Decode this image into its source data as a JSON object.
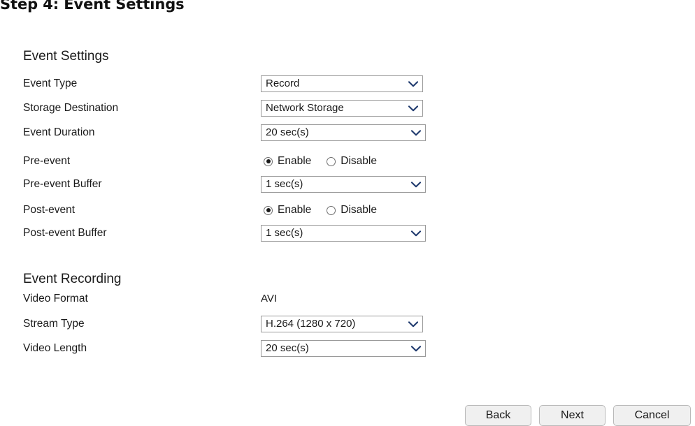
{
  "page": {
    "title": "Step 4: Event Settings"
  },
  "sections": [
    {
      "heading": "Event Settings",
      "rows": [
        {
          "label": "Event Type",
          "control": "select",
          "value": "Record"
        },
        {
          "label": "Storage Destination",
          "control": "select",
          "value": "Network Storage"
        },
        {
          "label": "Event Duration",
          "control": "select",
          "value": "20 sec(s)"
        },
        {
          "label": "Pre-event",
          "control": "radio",
          "options": [
            "Enable",
            "Disable"
          ],
          "selected": "Enable"
        },
        {
          "label": "Pre-event Buffer",
          "control": "select",
          "value": "1 sec(s)"
        },
        {
          "label": "Post-event",
          "control": "radio",
          "options": [
            "Enable",
            "Disable"
          ],
          "selected": "Enable"
        },
        {
          "label": "Post-event Buffer",
          "control": "select",
          "value": "1 sec(s)"
        }
      ]
    },
    {
      "heading": "Event Recording",
      "rows": [
        {
          "label": "Video Format",
          "control": "text",
          "value": "AVI"
        },
        {
          "label": "Stream Type",
          "control": "select",
          "value": "H.264 (1280 x 720)"
        },
        {
          "label": "Video Length",
          "control": "select",
          "value": "20 sec(s)"
        }
      ]
    }
  ],
  "footer": {
    "buttons": [
      {
        "label": "Back"
      },
      {
        "label": "Next"
      },
      {
        "label": "Cancel"
      }
    ]
  },
  "colors": {
    "page_background": "#ffffff",
    "text": "#1a1a1a",
    "select_border": "#9a9a9a",
    "button_face": "#f0f0f0",
    "button_border": "#b9b9b9"
  },
  "icons": {
    "chevron_down": "chevron-down-icon"
  }
}
